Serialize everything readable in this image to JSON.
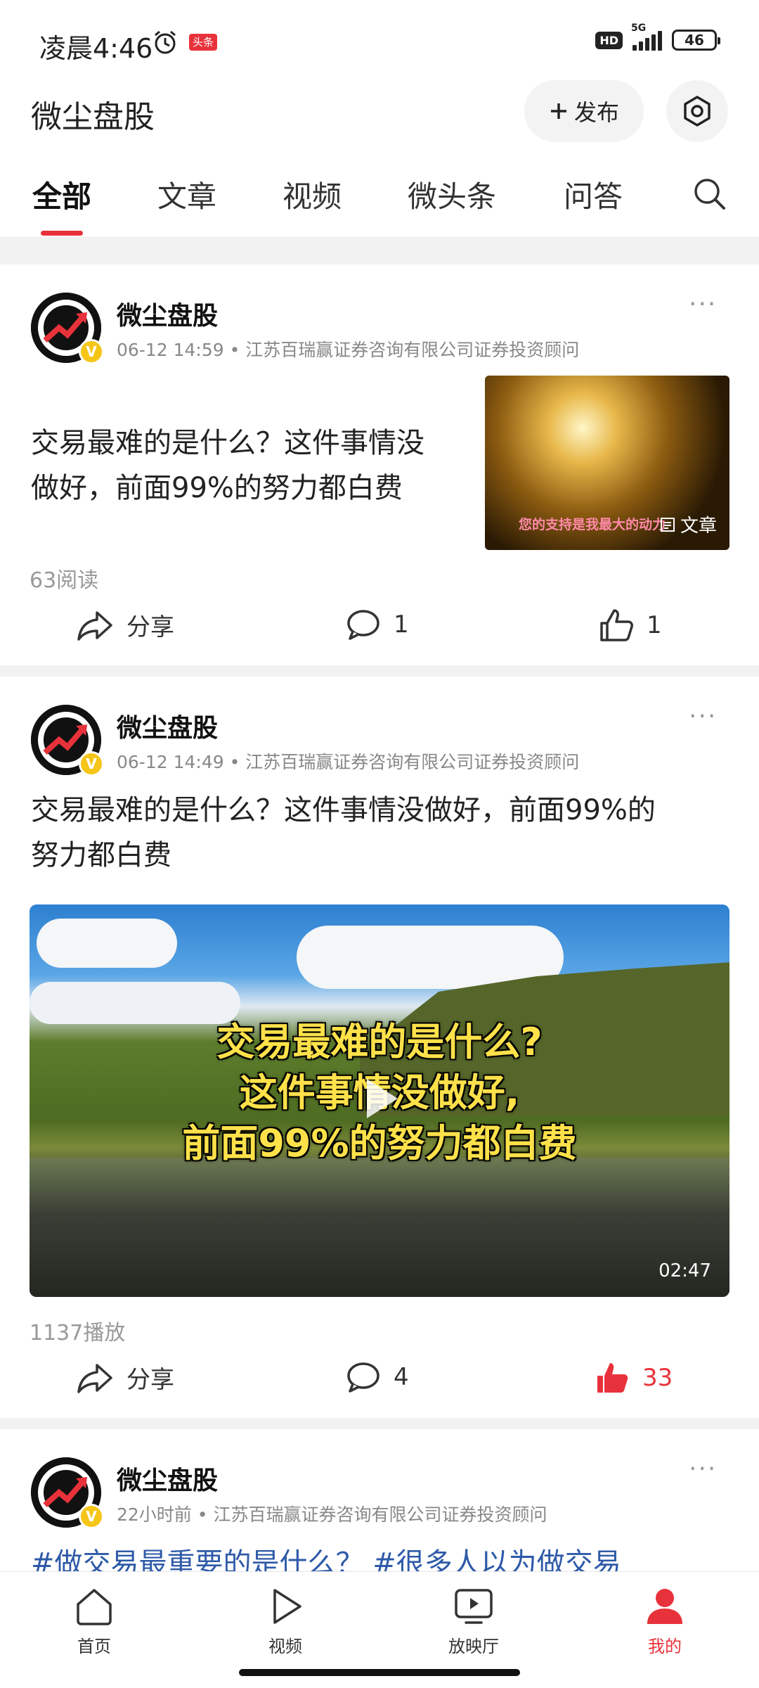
{
  "status": {
    "time": "凌晨4:46",
    "news_badge": "头条",
    "hd": "HD",
    "network": "5G",
    "battery": "46"
  },
  "header": {
    "title": "微尘盘股",
    "publish_label": "发布"
  },
  "tabs": [
    "全部",
    "文章",
    "视频",
    "微头条",
    "问答"
  ],
  "posts": [
    {
      "author": "微尘盘股",
      "time": "06-12 14:59",
      "cert": "江苏百瑞赢证券咨询有限公司证券投资顾问",
      "text_line1": "交易最难的是什么？这件事情没",
      "text_line2": "做好，前面99%的努力都白费",
      "thumb_caption": "您的支持是我最大的动力",
      "thumb_tag": "文章",
      "stat": "63阅读",
      "share_label": "分享",
      "comments": "1",
      "likes": "1"
    },
    {
      "author": "微尘盘股",
      "time": "06-12 14:49",
      "cert": "江苏百瑞赢证券咨询有限公司证券投资顾问",
      "text_line1": "交易最难的是什么？这件事情没做好，前面99%的",
      "text_line2": "努力都白费",
      "video_line1": "交易最难的是什么?",
      "video_line2": "这件事情没做好,",
      "video_line3": "前面99%的努力都白费",
      "duration": "02:47",
      "stat": "1137播放",
      "share_label": "分享",
      "comments": "4",
      "likes": "33"
    },
    {
      "author": "微尘盘股",
      "time": "22小时前",
      "cert": "江苏百瑞赢证券咨询有限公司证券投资顾问",
      "text_line1": "#做交易最重要的是什么？ #很多人以为做交易"
    }
  ],
  "bottom_nav": [
    "首页",
    "视频",
    "放映厅",
    "我的"
  ],
  "colors": {
    "accent": "#e8323b",
    "link": "#2e5aa8"
  }
}
